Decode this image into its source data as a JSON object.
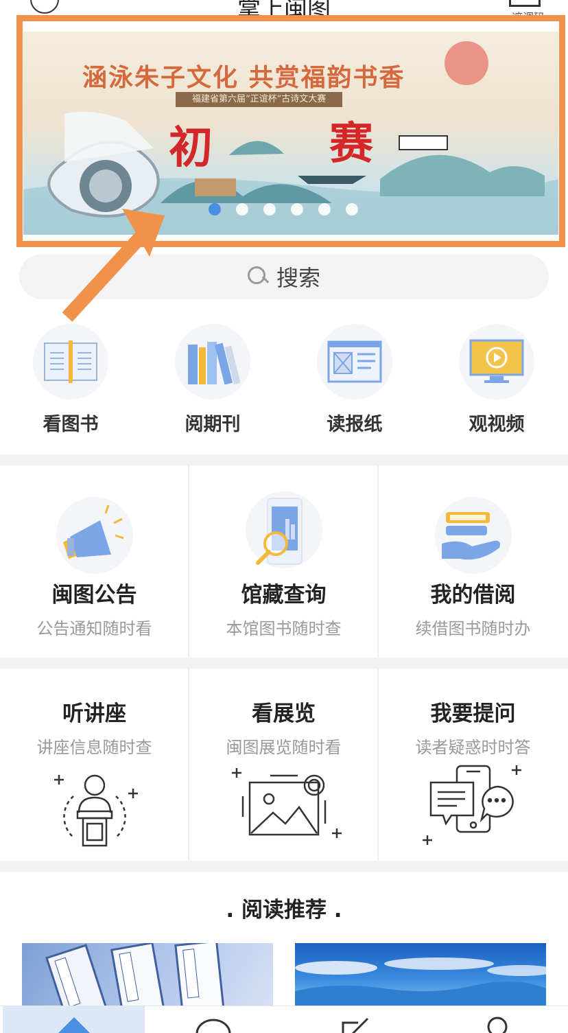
{
  "header": {
    "title": "掌上闽图",
    "right_label": "遮调码"
  },
  "banner": {
    "headline": "涵泳朱子文化  共赏福韵书香",
    "subtitle": "福建省第六届“正谊杯”古诗文大赛",
    "stage_left": "初",
    "stage_right": "赛",
    "slide_count": 6,
    "active_slide": 1
  },
  "search": {
    "placeholder": "搜索"
  },
  "quick_links": [
    {
      "label": "看图书",
      "icon": "book-icon"
    },
    {
      "label": "阅期刊",
      "icon": "magazines-icon"
    },
    {
      "label": "读报纸",
      "icon": "newspaper-icon"
    },
    {
      "label": "观视频",
      "icon": "video-icon"
    }
  ],
  "services_row1": [
    {
      "title": "闽图公告",
      "desc": "公告通知随时看",
      "icon": "megaphone-icon"
    },
    {
      "title": "馆藏查询",
      "desc": "本馆图书随时查",
      "icon": "search-phone-icon"
    },
    {
      "title": "我的借阅",
      "desc": "续借图书随时办",
      "icon": "hand-book-icon"
    }
  ],
  "services_row2": [
    {
      "title": "听讲座",
      "desc": "讲座信息随时查",
      "icon": "lecturer-icon"
    },
    {
      "title": "看展览",
      "desc": "闽图展览随时看",
      "icon": "picture-icon"
    },
    {
      "title": "我要提问",
      "desc": "读者疑惑时时答",
      "icon": "chat-phone-icon"
    }
  ],
  "recommend": {
    "title": ". 阅读推荐 ."
  },
  "tabs": [
    {
      "name": "home-icon",
      "active": true
    },
    {
      "name": "message-icon",
      "active": false
    },
    {
      "name": "edit-icon",
      "active": false
    },
    {
      "name": "user-icon",
      "active": false
    }
  ],
  "colors": {
    "accent": "#4a90e2",
    "highlight": "#f0924a",
    "banner_red": "#d3272a"
  }
}
